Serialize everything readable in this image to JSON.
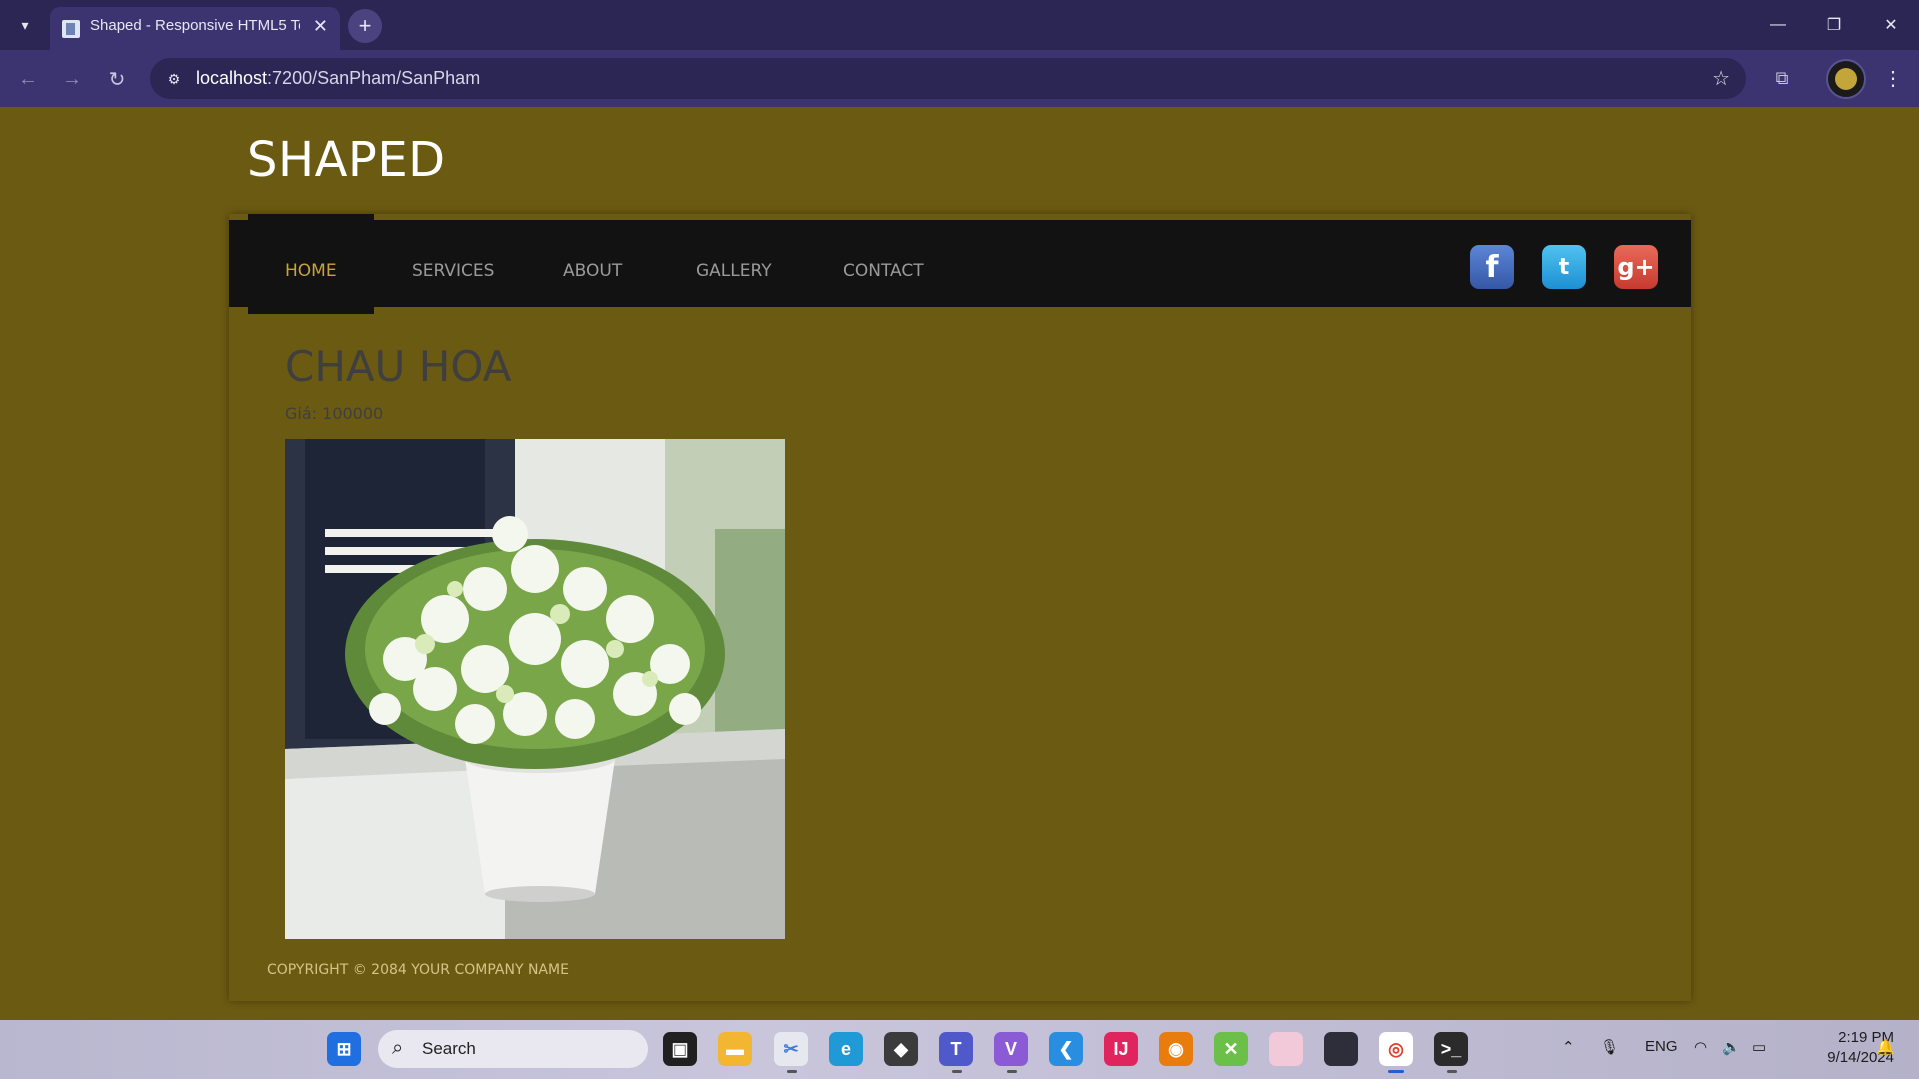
{
  "browser": {
    "tab_title": "Shaped - Responsive HTML5 Te",
    "url_host": "localhost",
    "url_path": ":7200/SanPham/SanPham"
  },
  "site": {
    "logo": "SHAPED",
    "nav": [
      "HOME",
      "SERVICES",
      "ABOUT",
      "GALLERY",
      "CONTACT"
    ],
    "active_nav": "HOME",
    "social": [
      "facebook-icon",
      "twitter-icon",
      "google-plus-icon"
    ],
    "social_labels": {
      "facebook": "f",
      "twitter": "t",
      "google_plus": "g+"
    }
  },
  "product": {
    "name": "CHAU HOA",
    "price_label": "Giá:",
    "price": "100000",
    "image": "potted-white-flowers"
  },
  "footer": {
    "copyright": "COPYRIGHT © 2084 YOUR COMPANY NAME"
  },
  "taskbar": {
    "search_label": "Search",
    "language": "ENG",
    "time": "2:19 PM",
    "date": "9/14/2024"
  },
  "colors": {
    "page_bg": "#6b5a12",
    "navbar_bg": "#121212",
    "nav_active": "#c8a43a",
    "nav_text": "#9a9a9a",
    "browser_frame": "#2b2653"
  }
}
